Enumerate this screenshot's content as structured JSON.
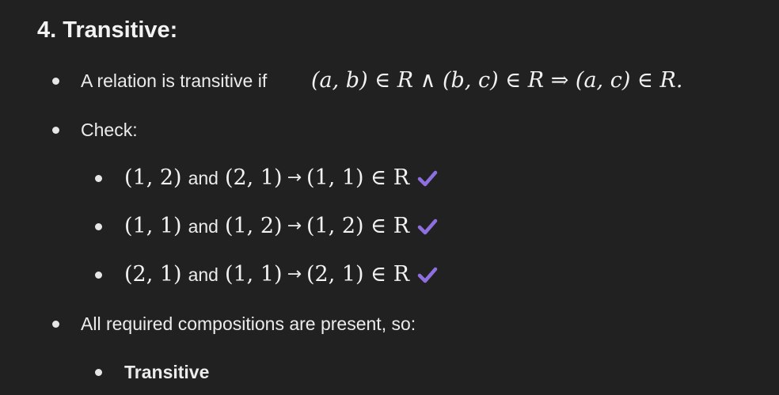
{
  "heading": "4. Transitive:",
  "definition": {
    "prefix": "A relation is transitive if",
    "math": "(a, b) ∈ R ∧ (b, c) ∈ R ⇒ (a, c) ∈ R."
  },
  "check_label": "Check:",
  "checks": [
    {
      "first": "(1, 2)",
      "joiner": "and",
      "second": "(2, 1)",
      "arrow": "→",
      "result": "(1, 1) ∈ R"
    },
    {
      "first": "(1, 1)",
      "joiner": "and",
      "second": "(1, 2)",
      "arrow": "→",
      "result": "(1, 2) ∈ R"
    },
    {
      "first": "(2, 1)",
      "joiner": "and",
      "second": "(1, 1)",
      "arrow": "→",
      "result": "(2, 1) ∈ R"
    }
  ],
  "conclusion": "All required compositions are present, so:",
  "verdict": "Transitive",
  "colors": {
    "background": "#212121",
    "text": "#ececec",
    "check": "#8e6fe0"
  },
  "icons": {
    "bullet": "filled-circle",
    "check": "checkmark-icon"
  }
}
